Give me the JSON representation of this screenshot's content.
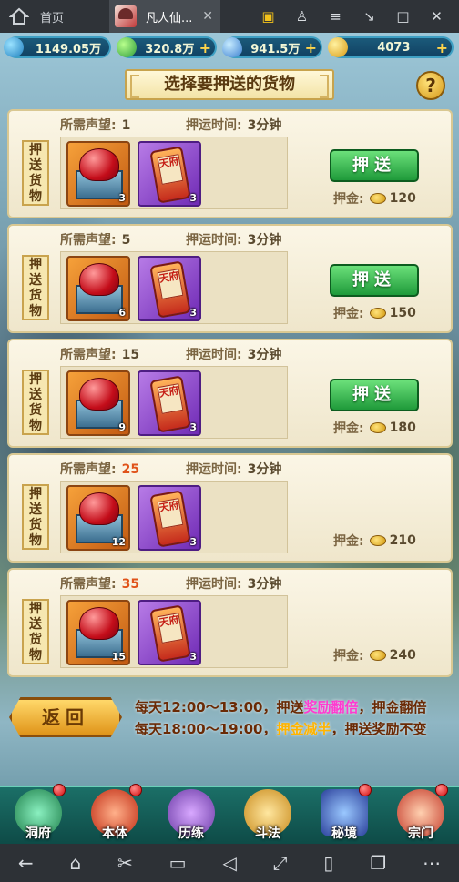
{
  "topbar": {
    "home_label": "首页",
    "game_tab_label": "凡人仙...",
    "close_glyph": "✕",
    "icons": [
      "tv-icon",
      "person-settings-icon",
      "menu-icon",
      "minimize-icon",
      "restore-icon",
      "close-icon"
    ],
    "icon_glyphs": [
      "▣",
      "♙",
      "≡",
      "↘",
      "□",
      "✕"
    ]
  },
  "currency": [
    {
      "name": "diamond-icon",
      "value": "1149.05万",
      "plus": ""
    },
    {
      "name": "jade-icon",
      "value": "320.8万",
      "plus": "+"
    },
    {
      "name": "water-drop-icon",
      "value": "941.5万",
      "plus": "+"
    },
    {
      "name": "gold-ingot-icon",
      "value": "4073",
      "plus": "+"
    }
  ],
  "title": "选择要押送的货物",
  "help": "?",
  "labels": {
    "tag": "押送货物",
    "req": "所需声望:",
    "time": "押运时间:",
    "deposit": "押金:",
    "escort_button": "押送",
    "seal": "天府"
  },
  "rows": [
    {
      "req": "1",
      "req_red": false,
      "time": "3分钟",
      "box_count": "3",
      "book_count": "3",
      "has_button": true,
      "deposit": "120"
    },
    {
      "req": "5",
      "req_red": false,
      "time": "3分钟",
      "box_count": "6",
      "book_count": "3",
      "has_button": true,
      "deposit": "150"
    },
    {
      "req": "15",
      "req_red": false,
      "time": "3分钟",
      "box_count": "9",
      "book_count": "3",
      "has_button": true,
      "deposit": "180"
    },
    {
      "req": "25",
      "req_red": true,
      "time": "3分钟",
      "box_count": "12",
      "book_count": "3",
      "has_button": false,
      "deposit": "210"
    },
    {
      "req": "35",
      "req_red": true,
      "time": "3分钟",
      "box_count": "15",
      "book_count": "3",
      "has_button": false,
      "deposit": "240"
    }
  ],
  "back_button": "返回",
  "notice": {
    "line1_a": "每天12:00～13:00，押送",
    "line1_hl": "奖励翻倍",
    "line1_b": "，押金翻倍",
    "line2_a": "每天18:00～19:00，",
    "line2_hl": "押金减半",
    "line2_b": "，押送奖励不变"
  },
  "nav": [
    {
      "label": "洞府",
      "dot": true
    },
    {
      "label": "本体",
      "dot": true
    },
    {
      "label": "历练",
      "dot": false
    },
    {
      "label": "斗法",
      "dot": false
    },
    {
      "label": "秘境",
      "dot": true
    },
    {
      "label": "宗门",
      "dot": true
    }
  ],
  "android_icons": [
    "back-icon",
    "home-icon",
    "cut-icon",
    "folder-icon",
    "volume-icon",
    "fullscreen-icon",
    "rotate-icon",
    "multiwindow-icon",
    "more-icon"
  ],
  "android_glyphs": [
    "←",
    "⌂",
    "✂",
    "▭",
    "◁",
    "⤢",
    "▯",
    "❐",
    "⋯"
  ],
  "colors": {
    "button_green": "#1f9a3a",
    "highlight_pink": "#ff3ad0",
    "highlight_gold": "#ffb400",
    "red_req": "#e0531a"
  }
}
